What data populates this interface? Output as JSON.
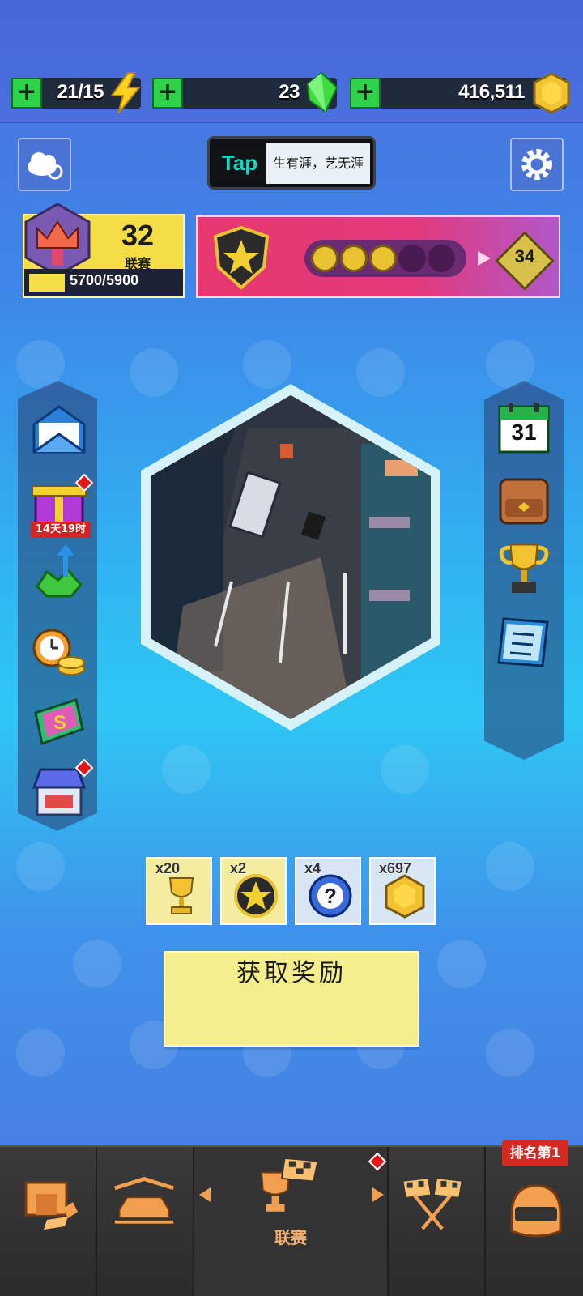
{
  "resources": {
    "energy": "21/15",
    "gems": "23",
    "coins": "416,511"
  },
  "header": {
    "tap_logo": "Tap",
    "tap_slogan": "生有涯，艺无涯"
  },
  "league": {
    "rank_number": "32",
    "label": "联赛",
    "progress_text": "5700/5900",
    "progress_fraction": 0.966
  },
  "star_pass": {
    "stars_filled": 3,
    "stars_total": 5,
    "level": "34"
  },
  "left_menu": {
    "gift_timer": "14天19时"
  },
  "right_menu": {
    "calendar_day": "31"
  },
  "rewards": [
    {
      "count": "x20",
      "icon": "trophy-icon"
    },
    {
      "count": "x2",
      "icon": "star-medal-icon"
    },
    {
      "count": "x4",
      "icon": "mystery-token-icon"
    },
    {
      "count": "x697",
      "icon": "coin-icon"
    }
  ],
  "claim_button": "获取奖励",
  "nav": {
    "league_label": "联赛",
    "rank_badge": "排名第1"
  },
  "colors": {
    "accent_yellow": "#f4dd46",
    "plus_green": "#2dd44a",
    "nav_orange": "#f2ad68"
  }
}
